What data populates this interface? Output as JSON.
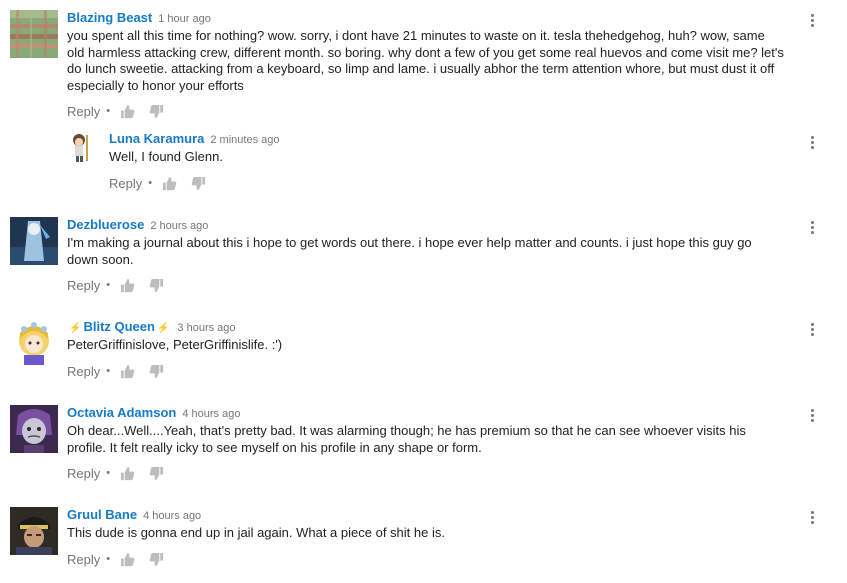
{
  "colors": {
    "author_link": "#167ac6",
    "meta_gray": "#767676",
    "text": "#222222"
  },
  "icons": {
    "like": "thumbs-up-icon",
    "dislike": "thumbs-down-icon",
    "menu": "vertical-dots-menu-icon"
  },
  "reply_label": "Reply",
  "separator": "•",
  "comments": [
    {
      "author": "Blazing Beast",
      "time": "1 hour ago",
      "text": "you spent all this time for nothing? wow. sorry, i dont have 21 minutes to waste on it.  tesla thehedgehog, huh? wow, same old harmless attacking crew, different month. so boring. why dont a few of you get some real huevos and come visit me? let's do lunch sweetie. attacking from a keyboard, so limp  and lame. i usually abhor the term attention whore, but must dust it off especially to honor your efforts"
    },
    {
      "author": "Luna Karamura",
      "time": "2 minutes ago",
      "text": "Well, I found Glenn."
    },
    {
      "author": "Dezbluerose",
      "time": "2 hours ago",
      "text": "I'm making a journal about this i hope to get words out there. i hope ever help matter and counts. i just hope this guy go down soon."
    },
    {
      "author": "Blitz Queen",
      "bolt": "⚡",
      "time": "3 hours ago",
      "text": "PeterGriffinislove, PeterGriffinislife. :')"
    },
    {
      "author": "Octavia Adamson",
      "time": "4 hours ago",
      "text": "Oh dear...Well....Yeah, that's pretty bad. It was alarming though; he has premium so that he can see whoever visits his profile. It felt really icky to see myself on his profile in any shape or form."
    },
    {
      "author": "Gruul Bane",
      "time": "4 hours ago",
      "text": "This dude is gonna end up in jail again. What a piece of shit he is."
    }
  ]
}
